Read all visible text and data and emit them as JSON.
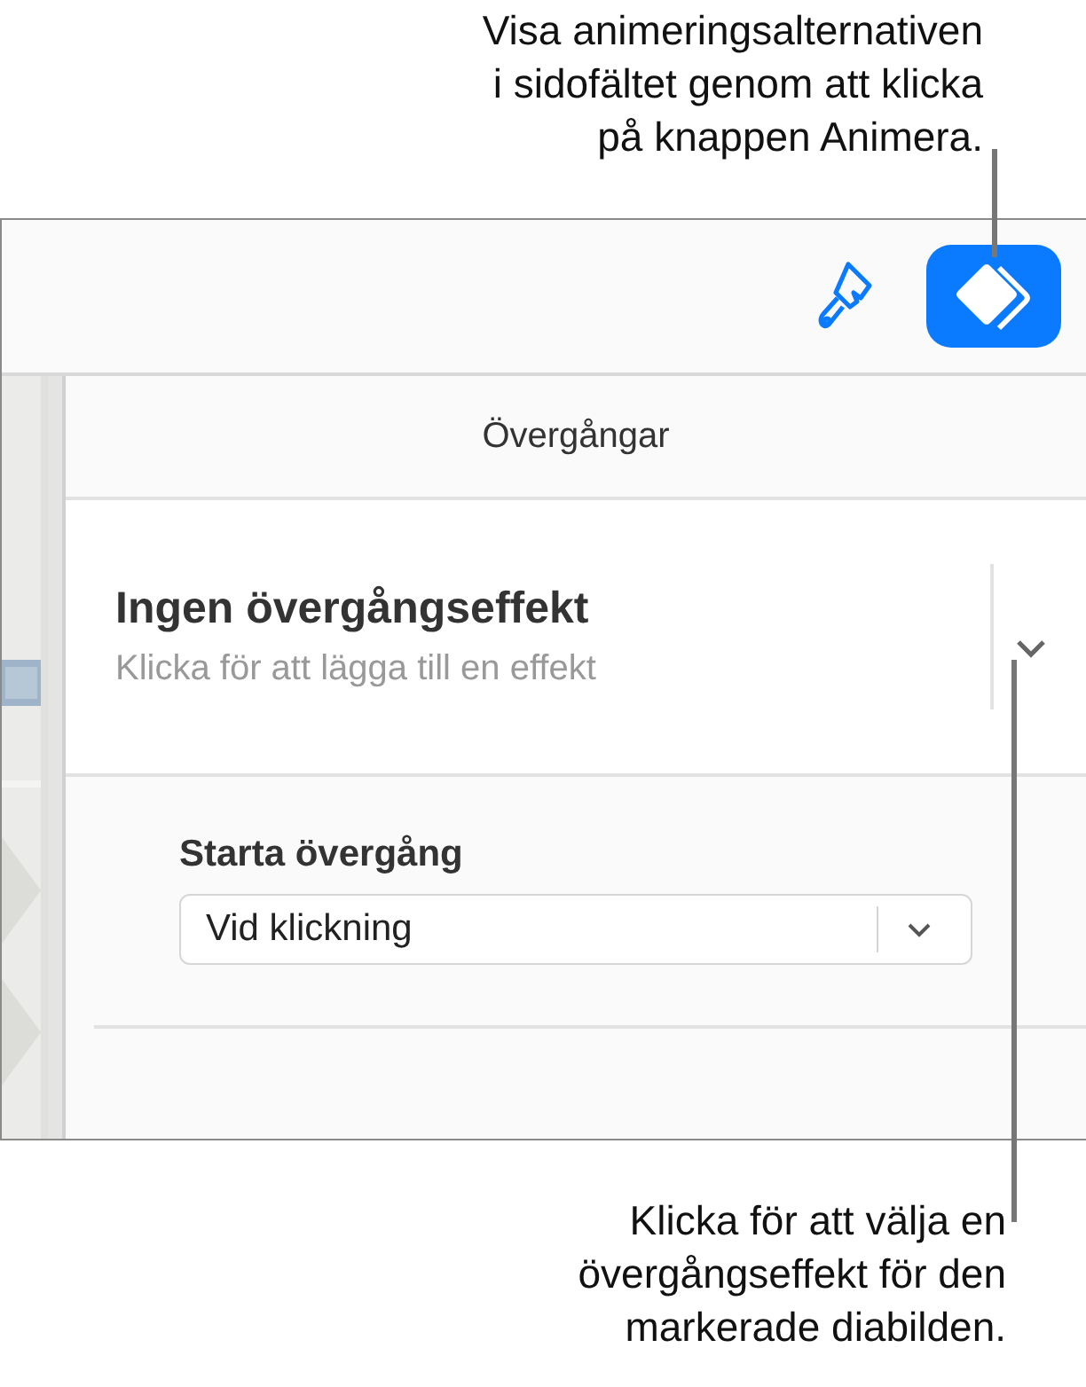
{
  "top_callout": {
    "lines": [
      "Visa animeringsalternativen",
      "i sidofältet genom att klicka",
      "på knappen Animera."
    ]
  },
  "toolbar": {
    "buttons": [
      {
        "kind": "format",
        "selected": false
      },
      {
        "kind": "animate",
        "selected": true
      }
    ]
  },
  "sidebar": {
    "title": "Övergångar",
    "effect": {
      "title": "Ingen övergångseffekt",
      "subtitle": "Klicka för att lägga till en effekt"
    },
    "start": {
      "label": "Starta övergång",
      "value": "Vid klickning"
    }
  },
  "bottom_callout": {
    "lines": [
      "Klicka för att välja en",
      "övergångseffekt för den",
      "markerade diabilden."
    ]
  }
}
